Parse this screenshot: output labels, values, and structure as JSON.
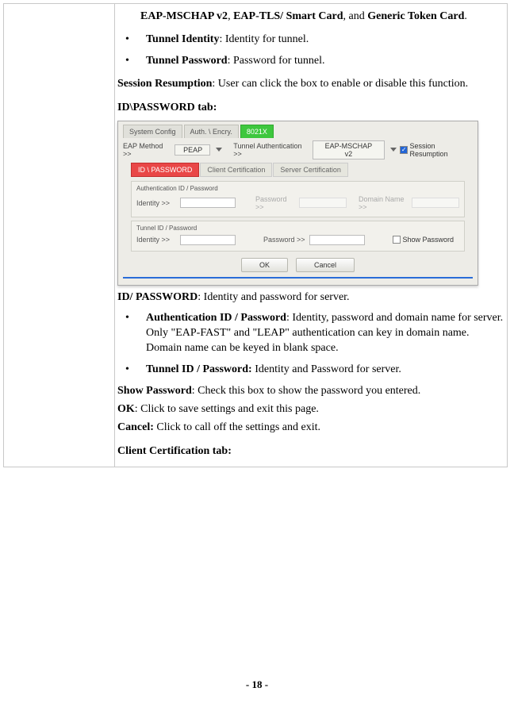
{
  "intro_line": {
    "b1": "EAP-MSCHAP v2",
    "sep1": ", ",
    "b2": "EAP-TLS/ Smart Card",
    "sep2": ", and ",
    "b3": "Generic Token Card",
    "tail": "."
  },
  "bullets_top": [
    {
      "bold": "Tunnel Identity",
      "rest": ": Identity for tunnel."
    },
    {
      "bold": "Tunnel Password",
      "rest": ": Password for tunnel."
    }
  ],
  "session_resumption": {
    "bold": "Session Resumption",
    "rest": ": User can click the box to enable or disable this function."
  },
  "id_pw_heading": "ID\\PASSWORD tab:",
  "screenshot": {
    "top_tabs": [
      "System Config",
      "Auth. \\ Encry.",
      "8021X"
    ],
    "eap_method_lbl": "EAP Method >>",
    "eap_method_val": "PEAP",
    "tunnel_auth_lbl": "Tunnel Authentication >>",
    "tunnel_auth_val": "EAP-MSCHAP v2",
    "session_res_lbl": "Session Resumption",
    "sub_tabs": [
      "ID \\ PASSWORD",
      "Client Certification",
      "Server Certification"
    ],
    "group1_title": "Authentication ID / Password",
    "g1_id_lbl": "Identity >>",
    "g1_pw_lbl": "Password >>",
    "g1_dn_lbl": "Domain Name >>",
    "group2_title": "Tunnel ID / Password",
    "g2_id_lbl": "Identity >>",
    "g2_pw_lbl": "Password >>",
    "show_pw_lbl": "Show Password",
    "btn_ok": "OK",
    "btn_cancel": "Cancel"
  },
  "idpw_desc": {
    "bold": "ID/ PASSWORD",
    "rest": ": Identity and password for server."
  },
  "bullets_mid": [
    {
      "bold": "Authentication ID / Password",
      "rest": ": Identity, password and domain name for server. Only \"EAP-FAST\" and \"LEAP\" authentication can key in domain name. Domain name can be keyed in blank space."
    },
    {
      "bold": "Tunnel ID / Password:",
      "rest": " Identity and Password for server."
    }
  ],
  "show_pw_desc": {
    "bold": "Show Password",
    "rest": ": Check this box to show the password you entered."
  },
  "ok_desc": {
    "bold": "OK",
    "rest": ": Click to save settings and exit this page."
  },
  "cancel_desc": {
    "bold": "Cancel:",
    "rest": " Click to call off the settings and exit."
  },
  "client_cert_heading": "Client Certification tab:",
  "page_number": "- 18 -"
}
